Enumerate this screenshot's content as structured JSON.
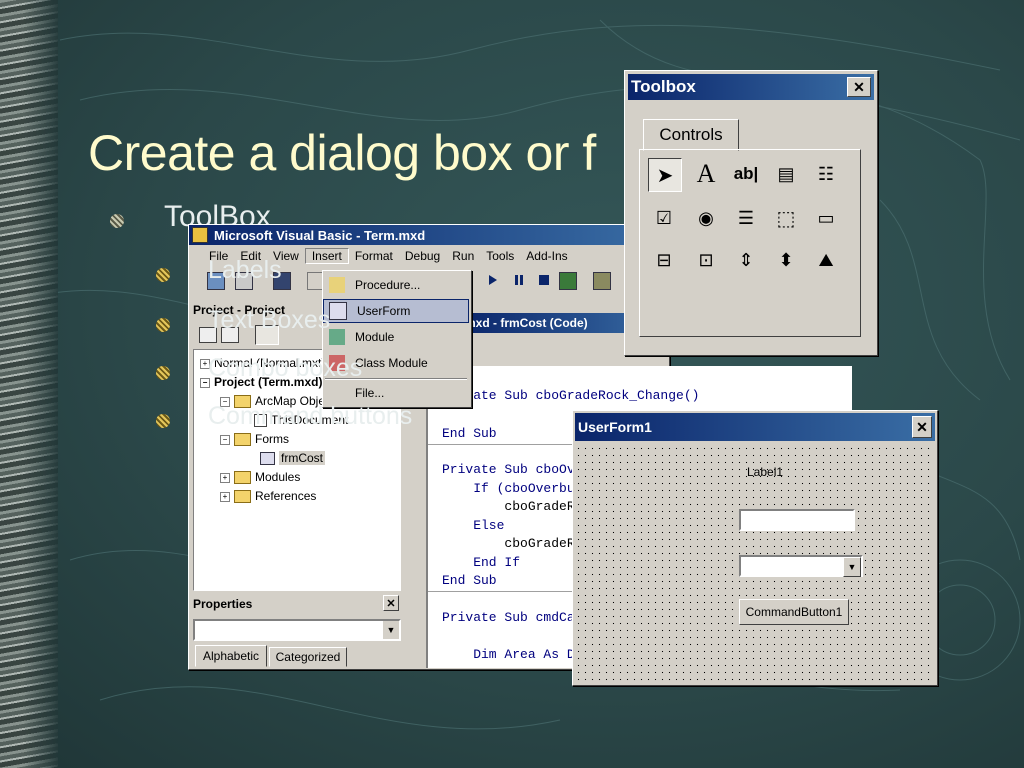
{
  "slide": {
    "title": "Create a dialog box or f",
    "bullets": [
      {
        "text": "ToolBox",
        "level": 1
      },
      {
        "text": "Labels",
        "level": 2
      },
      {
        "text": "Text Boxes",
        "level": 2
      },
      {
        "text": "Combo boxes",
        "level": 2
      },
      {
        "text": "Command buttons",
        "level": 2
      }
    ]
  },
  "vb": {
    "title": "Microsoft Visual Basic - Term.mxd",
    "menus": [
      "File",
      "Edit",
      "View",
      "Insert",
      "Format",
      "Debug",
      "Run",
      "Tools",
      "Add-Ins"
    ],
    "project_title": "Project - Project",
    "tree": [
      "Normal (Normal.mxt)",
      "Project (Term.mxd)",
      "ArcMap Objects",
      "ThisDocument",
      "Forms",
      "frmCost",
      "Modules",
      "References"
    ],
    "properties_title": "Properties",
    "prop_tabs": [
      "Alphabetic",
      "Categorized"
    ],
    "code_title": "mxd - frmCost (Code)",
    "code_lines": [
      "Private Sub cboGradeRock_Change()",
      "End Sub",
      "Private Sub cboOverburden_Change()",
      "    If (cboOverburden.Text = \"\") Then",
      "        cboGradeRock.Enabled = False",
      "    Else",
      "        cboGradeRock.Enabled = True",
      "    End If",
      "End Sub",
      "Private Sub cmdCalculate_Click()",
      "    Dim Area As Double"
    ]
  },
  "insert_menu": {
    "items": [
      "Procedure...",
      "UserForm",
      "Module",
      "Class Module",
      "File..."
    ],
    "highlighted": "UserForm"
  },
  "toolbox": {
    "title": "Toolbox",
    "tab": "Controls",
    "tools": [
      "pointer",
      "A",
      "ab|",
      "combobox",
      "listbox",
      "checkbox",
      "option",
      "toggle",
      "frame",
      "commandbutton",
      "tabstrip",
      "multipage",
      "scrollbar",
      "spinbutton",
      "image"
    ]
  },
  "userform": {
    "title": "UserForm1",
    "label": "Label1",
    "button": "CommandButton1"
  }
}
